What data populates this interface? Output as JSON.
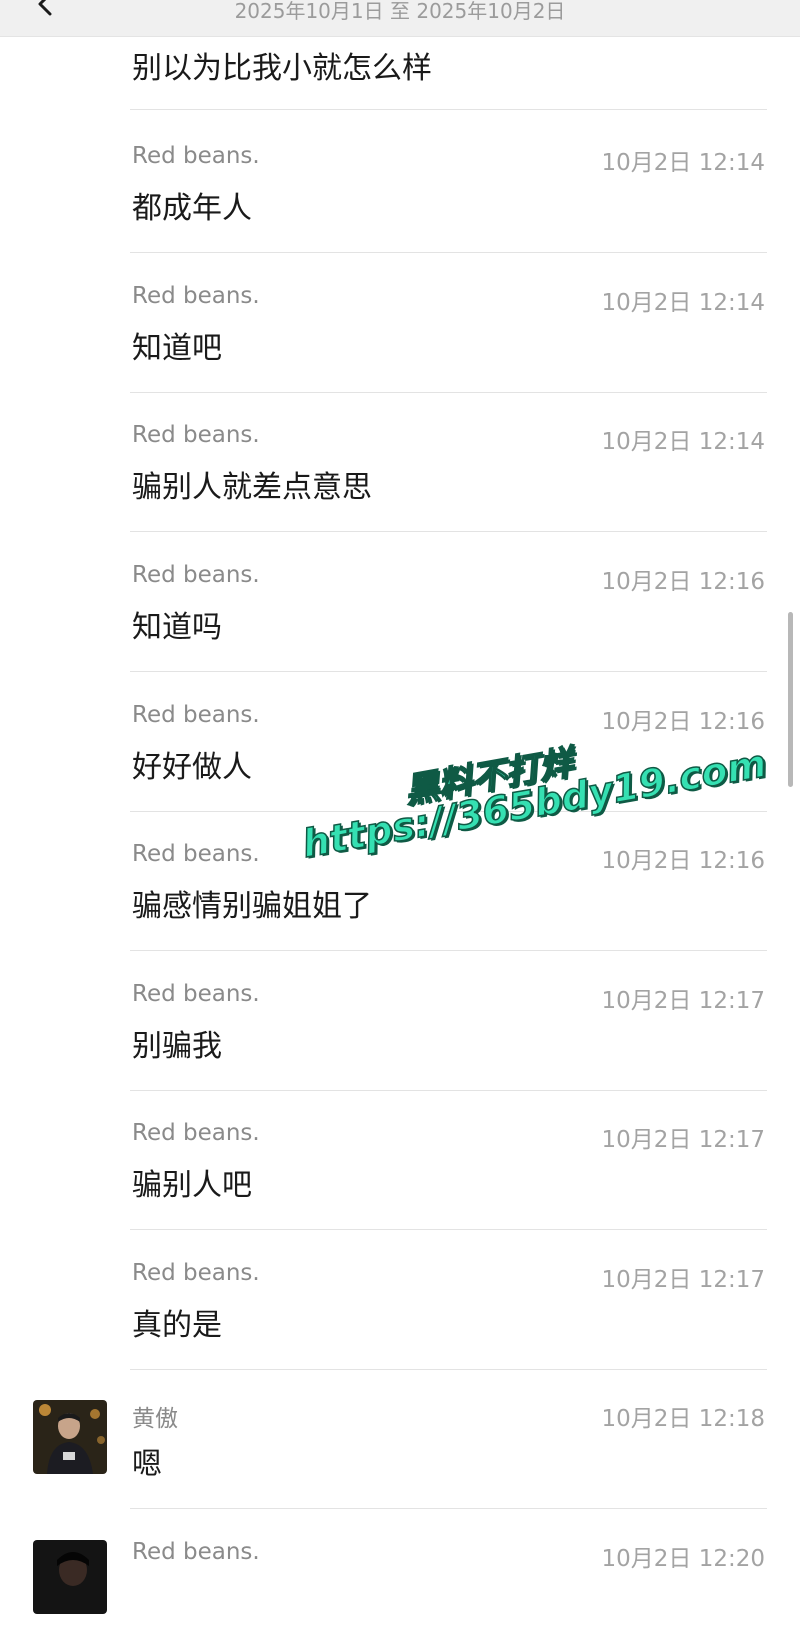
{
  "header": {
    "date_range": "2025年10月1日 至 2025年10月2日"
  },
  "first_message": {
    "text": "别以为比我小就怎么样"
  },
  "messages": [
    {
      "sender": "Red  beans.",
      "time": "10月2日 12:14",
      "text": "都成年人"
    },
    {
      "sender": "Red  beans.",
      "time": "10月2日 12:14",
      "text": "知道吧"
    },
    {
      "sender": "Red  beans.",
      "time": "10月2日 12:14",
      "text": "骗别人就差点意思"
    },
    {
      "sender": "Red  beans.",
      "time": "10月2日 12:16",
      "text": "知道吗"
    },
    {
      "sender": "Red  beans.",
      "time": "10月2日 12:16",
      "text": "好好做人"
    },
    {
      "sender": "Red  beans.",
      "time": "10月2日 12:16",
      "text": "骗感情别骗姐姐了"
    },
    {
      "sender": "Red  beans.",
      "time": "10月2日 12:17",
      "text": "别骗我"
    },
    {
      "sender": "Red  beans.",
      "time": "10月2日 12:17",
      "text": "骗别人吧"
    },
    {
      "sender": "Red  beans.",
      "time": "10月2日 12:17",
      "text": "真的是"
    },
    {
      "sender": "黄傲",
      "time": "10月2日 12:18",
      "text": "嗯"
    },
    {
      "sender": "Red  beans.",
      "time": "10月2日 12:20",
      "text": ""
    }
  ],
  "watermark": {
    "line1": "黑料不打烊",
    "line2": "https://365bdy19.com"
  },
  "colors": {
    "header_bg": "#f0f0f0",
    "watermark": "#35e0b2",
    "sender": "#8a8a8a",
    "text": "#1a1a1a"
  }
}
